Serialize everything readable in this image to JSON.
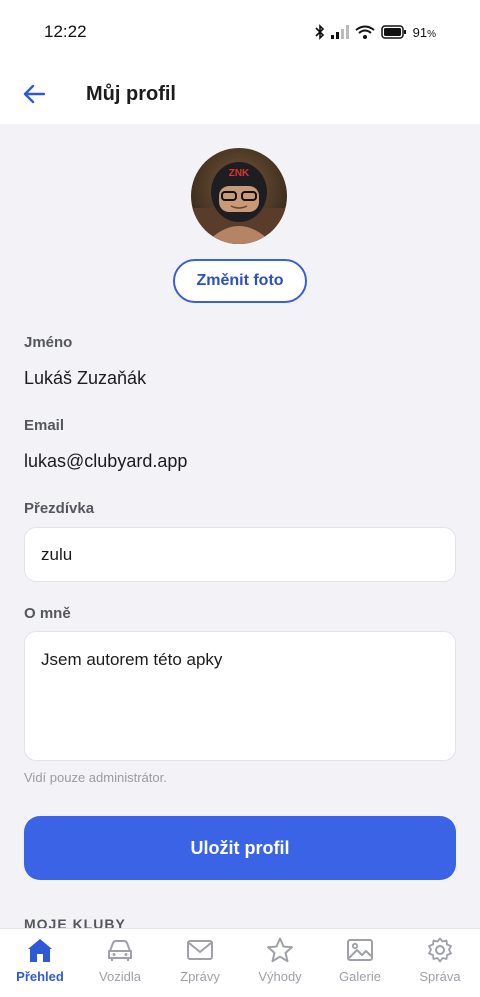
{
  "status_bar": {
    "time": "12:22",
    "battery": "91",
    "battery_unit": "%"
  },
  "app_bar": {
    "title": "Můj profil"
  },
  "profile": {
    "avatar_text": "ZNK",
    "change_photo_label": "Změnit foto",
    "name_label": "Jméno",
    "name_value": "Lukáš Zuzaňák",
    "email_label": "Email",
    "email_value": "lukas@clubyard.app",
    "nickname_label": "Přezdívka",
    "nickname_value": "zulu",
    "about_label": "O mně",
    "about_value": "Jsem autorem této apky",
    "about_hint": "Vidí pouze administrátor.",
    "save_label": "Uložit profil",
    "clubs_heading": "MOJE KLUBY"
  },
  "bottom_nav": {
    "items": [
      {
        "label": "Přehled",
        "icon": "home-icon",
        "active": true
      },
      {
        "label": "Vozidla",
        "icon": "car-icon",
        "active": false
      },
      {
        "label": "Zprávy",
        "icon": "mail-icon",
        "active": false
      },
      {
        "label": "Výhody",
        "icon": "star-icon",
        "active": false
      },
      {
        "label": "Galerie",
        "icon": "image-icon",
        "active": false
      },
      {
        "label": "Správa",
        "icon": "gear-icon",
        "active": false
      }
    ]
  },
  "colors": {
    "accent": "#3a63e6",
    "background": "#f2f2f7",
    "active_nav": "#2f5ad6"
  }
}
